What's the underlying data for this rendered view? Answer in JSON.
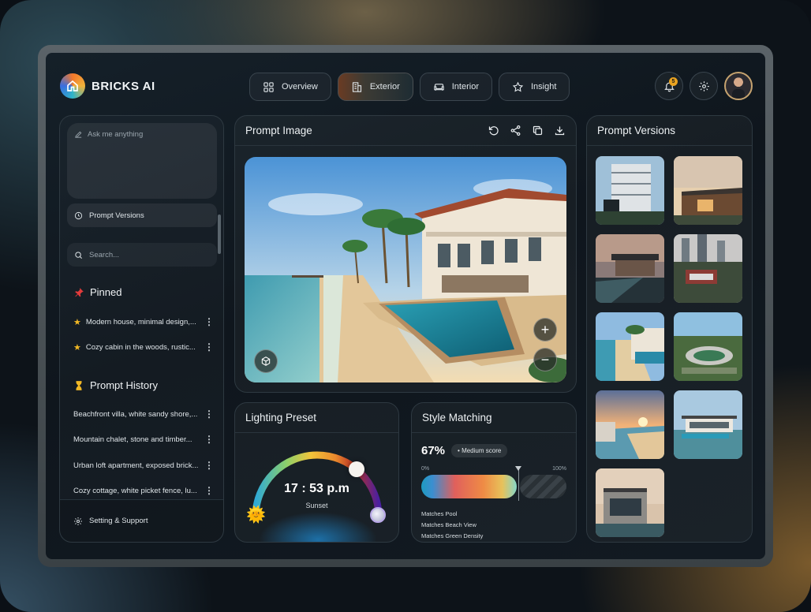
{
  "app": {
    "name": "BRICKS AI"
  },
  "nav": {
    "tabs": [
      {
        "label": "Overview",
        "icon": "grid-icon"
      },
      {
        "label": "Exterior",
        "icon": "building-icon",
        "active": true
      },
      {
        "label": "Interior",
        "icon": "sofa-icon"
      },
      {
        "label": "Insight",
        "icon": "star-icon"
      }
    ]
  },
  "header": {
    "notification_count": "5"
  },
  "sidebar": {
    "ask_placeholder": "Ask me anything",
    "prompt_versions_label": "Prompt Versions",
    "search_placeholder": "Search...",
    "pinned_title": "Pinned",
    "pinned": [
      "Modern house, minimal design,...",
      "Cozy cabin in the woods, rustic..."
    ],
    "history_title": "Prompt History",
    "history": [
      "Beachfront villa, white sandy shore,...",
      "Mountain chalet, stone and timber...",
      "Urban loft apartment, exposed brick...",
      "Cozy cottage, white picket fence, lu..."
    ],
    "footer_label": "Setting & Support"
  },
  "prompt_image": {
    "title": "Prompt Image"
  },
  "prompt_versions": {
    "title": "Prompt Versions",
    "count": 9
  },
  "lighting": {
    "title": "Lighting Preset",
    "time": "17 : 53 p.m",
    "preset": "Sunset",
    "level": 0.72
  },
  "style_matching": {
    "title": "Style Matching",
    "score": "67%",
    "score_value": 67,
    "badge": "Medium score",
    "min_label": "0%",
    "max_label": "100%",
    "matches": [
      "Matches Pool",
      "Matches Beach View",
      "Matches Green Density"
    ]
  },
  "colors": {
    "accent": "#f0b13a",
    "star": "#f2b825",
    "pin": "#e23b3b"
  }
}
